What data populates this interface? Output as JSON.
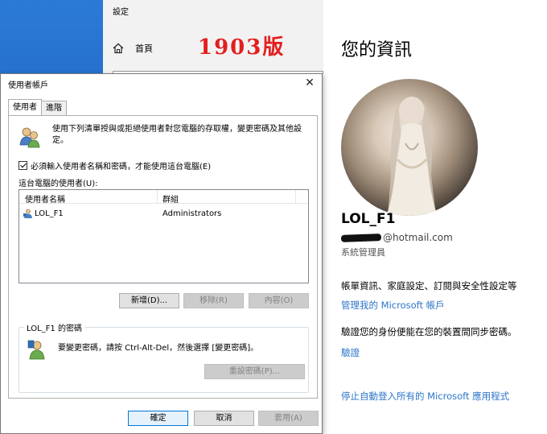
{
  "settings": {
    "title": "設定",
    "nav_home": "首頁",
    "version_badge": "1903版"
  },
  "profile": {
    "heading": "您的資訊",
    "username": "LOL_F1",
    "email_suffix": "@hotmail.com",
    "role": "系統管理員",
    "billing_desc": "帳單資訊、家庭設定、訂閱與安全性設定等",
    "manage_link": "管理我的 Microsoft 帳戶",
    "verify_desc": "驗證您的身份便能在您的裝置間同步密碼。",
    "verify_link": "驗證",
    "stop_autologin_link": "停止自動登入所有的 Microsoft 應用程式"
  },
  "dialog": {
    "title": "使用者帳戶",
    "close_glyph": "✕",
    "tabs": [
      {
        "label": "使用者",
        "active": true
      },
      {
        "label": "進階",
        "active": false
      }
    ],
    "intro": "使用下列清單授與或拒絕使用者對您電腦的存取權，變更密碼及其他設定。",
    "must_enter_checkbox": {
      "label": "必須輸入使用者名稱和密碼，才能使用這台電腦(E)",
      "checked": true
    },
    "list_label": "這台電腦的使用者(U):",
    "columns": [
      "使用者名稱",
      "群組"
    ],
    "rows": [
      {
        "name": "LOL_F1",
        "group": "Administrators"
      }
    ],
    "buttons": {
      "add": "新增(D)...",
      "remove": "移除(R)",
      "properties": "內容(O)"
    },
    "password_group": {
      "label": "LOL_F1 的密碼",
      "text": "要變更密碼，請按 Ctrl-Alt-Del，然後選擇 [變更密碼]。",
      "reset_button": "重設密碼(P)..."
    },
    "footer": {
      "ok": "確定",
      "cancel": "取消",
      "apply": "套用(A)"
    }
  },
  "colors": {
    "link": "#2b74c8",
    "badge": "#e31e1e",
    "dialog_accent": "#0078d7"
  }
}
